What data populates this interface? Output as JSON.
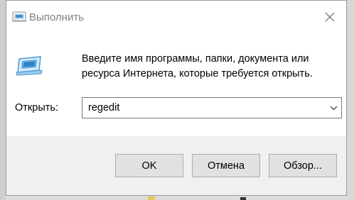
{
  "window": {
    "title": "Выполнить",
    "close_icon": "close-icon"
  },
  "content": {
    "icon": "run-program-icon",
    "description_line1": "Введите имя программы, папки, документа или",
    "description_line2": "ресурса Интернета, которые требуется открыть.",
    "open_label": "Открыть:",
    "open_value": "regedit",
    "dropdown_icon": "chevron-down-icon"
  },
  "buttons": {
    "ok": "OK",
    "cancel": "Отмена",
    "browse": "Обзор..."
  },
  "colors": {
    "title_text": "#808080",
    "button_bg": "#e1e1e1",
    "button_border": "#adadad",
    "footer_bg": "#f0f0f0",
    "icon_accent": "#4a9bd6"
  }
}
